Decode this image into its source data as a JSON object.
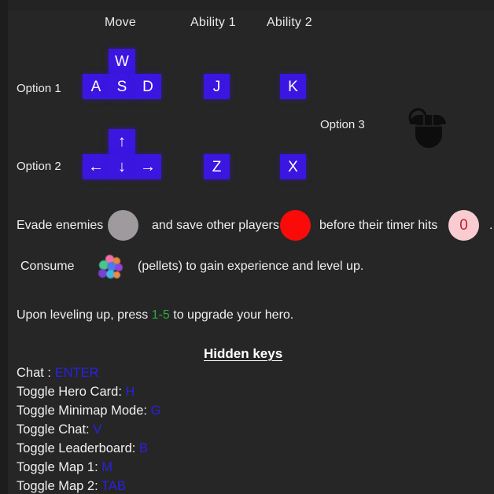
{
  "colors": {
    "background": "#262626",
    "key_cap": "#3a16e0",
    "key_text": "#ffffff",
    "enemy_circle": "#9e9a9d",
    "player_circle": "#fb0a0a",
    "timer_circle": "#f9ccd2",
    "timer_text": "#c4202a",
    "upgrade_keys": "#2fa83f",
    "hidden_key": "#2a21e2",
    "mouse_icon": "#0d0d0d"
  },
  "controls": {
    "column_headers": [
      {
        "label": "Move"
      },
      {
        "label": "Ability 1"
      },
      {
        "label": "Ability 2"
      }
    ],
    "options": [
      {
        "label": "Option 1",
        "move_keys": [
          "W",
          "A",
          "S",
          "D"
        ],
        "ability1": "J",
        "ability2": "K"
      },
      {
        "label": "Option 2",
        "move_keys": [
          "↑",
          "←",
          "↓",
          "→"
        ],
        "ability1": "Z",
        "ability2": "X"
      },
      {
        "label": "Option 3",
        "icon": "mouse-icon"
      }
    ]
  },
  "instructions": {
    "evade_prefix": "Evade enemies",
    "save_middle": "and save other players",
    "timer_text": "before their timer hits",
    "timer_value": "0",
    "trailing_period": ".",
    "consume_label": "Consume",
    "consume_suffix": "(pellets) to gain experience and level up.",
    "pellets_icon": "pellets-icon",
    "levelup_prefix": "Upon leveling up, press",
    "levelup_keys": "1-5",
    "levelup_suffix": "to upgrade your hero."
  },
  "hidden_keys": {
    "title": "Hidden keys",
    "rows": [
      {
        "label": "Chat :",
        "key": "ENTER"
      },
      {
        "label": "Toggle Hero Card:",
        "key": "H"
      },
      {
        "label": "Toggle Minimap Mode:",
        "key": "G"
      },
      {
        "label": "Toggle Chat:",
        "key": "V"
      },
      {
        "label": "Toggle Leaderboard:",
        "key": "B"
      },
      {
        "label": "Toggle Map 1:",
        "key": "M"
      },
      {
        "label": "Toggle Map 2:",
        "key": "TAB"
      }
    ]
  }
}
